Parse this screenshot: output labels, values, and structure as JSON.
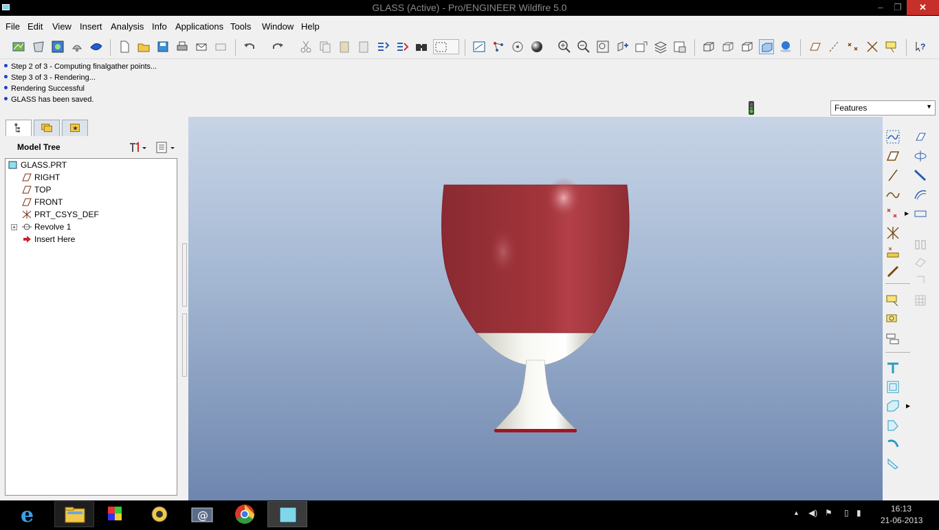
{
  "window": {
    "title": "GLASS (Active) - Pro/ENGINEER Wildfire 5.0",
    "minimize": "–",
    "restore": "❐",
    "close": "✕"
  },
  "menu": [
    "File",
    "Edit",
    "View",
    "Insert",
    "Analysis",
    "Info",
    "Applications",
    "Tools",
    "Window",
    "Help"
  ],
  "messages": [
    "Step 2 of 3 - Computing finalgather points...",
    "Step 3 of 3 - Rendering...",
    "Rendering Successful",
    "GLASS has been saved."
  ],
  "filter": {
    "value": "Features"
  },
  "model_tree": {
    "title": "Model Tree",
    "nodes": [
      {
        "label": "GLASS.PRT",
        "icon": "part-icon"
      },
      {
        "label": "RIGHT",
        "icon": "datum-plane-icon"
      },
      {
        "label": "TOP",
        "icon": "datum-plane-icon"
      },
      {
        "label": "FRONT",
        "icon": "datum-plane-icon"
      },
      {
        "label": "PRT_CSYS_DEF",
        "icon": "csys-icon"
      },
      {
        "label": "Revolve 1",
        "icon": "revolve-icon"
      },
      {
        "label": "Insert Here",
        "icon": "insert-arrow-icon"
      }
    ]
  },
  "model": {
    "bowl_color": "#a2353b",
    "body_color": "#f4f4ee",
    "base_rim_color": "#a01622"
  },
  "taskbar": {
    "time": "16:13",
    "date": "21-06-2013",
    "apps": [
      "internet-explorer-icon",
      "file-explorer-icon",
      "paint-app-icon",
      "media-app-icon",
      "email-app-icon",
      "chrome-icon",
      "proengineer-icon"
    ]
  }
}
